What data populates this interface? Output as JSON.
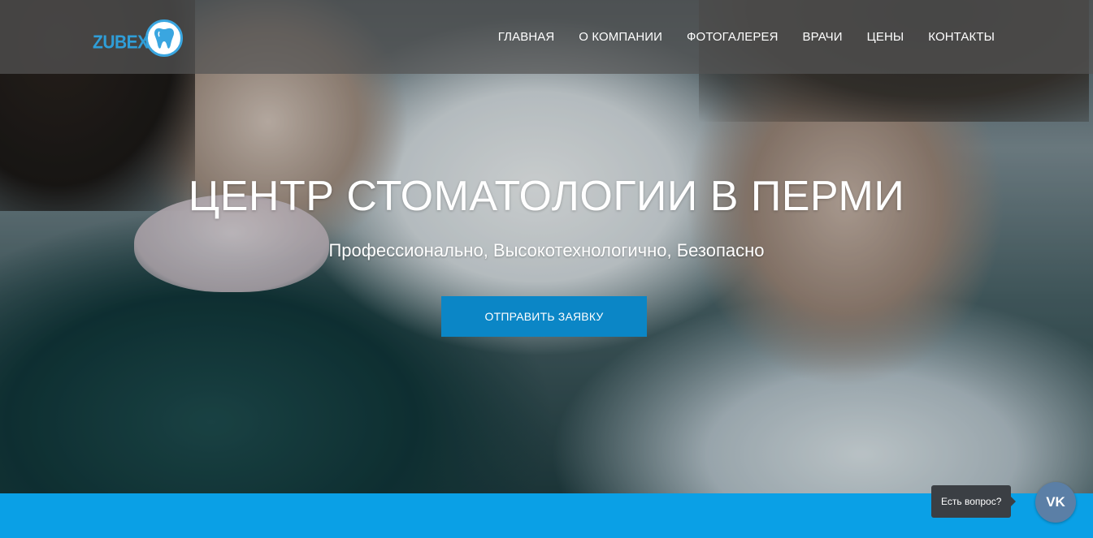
{
  "logo": {
    "text": "ZUBEX",
    "icon": "tooth-icon",
    "color": "#2f9ed8"
  },
  "nav": {
    "items": [
      {
        "label": "ГЛАВНАЯ"
      },
      {
        "label": "О КОМПАНИИ"
      },
      {
        "label": "ФОТОГАЛЕРЕЯ"
      },
      {
        "label": "ВРАЧИ"
      },
      {
        "label": "ЦЕНЫ"
      },
      {
        "label": "КОНТАКТЫ"
      }
    ]
  },
  "hero": {
    "title": "ЦЕНТР СТОМАТОЛОГИИ В ПЕРМИ",
    "subtitle": "Профессионально, Высокотехнологично, Безопасно",
    "cta_label": "ОТПРАВИТЬ ЗАЯВКУ",
    "cta_color": "#0b86c6"
  },
  "footer_strip": {
    "color": "#0aa0e6"
  },
  "vk_widget": {
    "tooltip": "Есть вопрос?",
    "icon": "vk-icon",
    "icon_text": "VK",
    "color": "#5b7fa6"
  }
}
